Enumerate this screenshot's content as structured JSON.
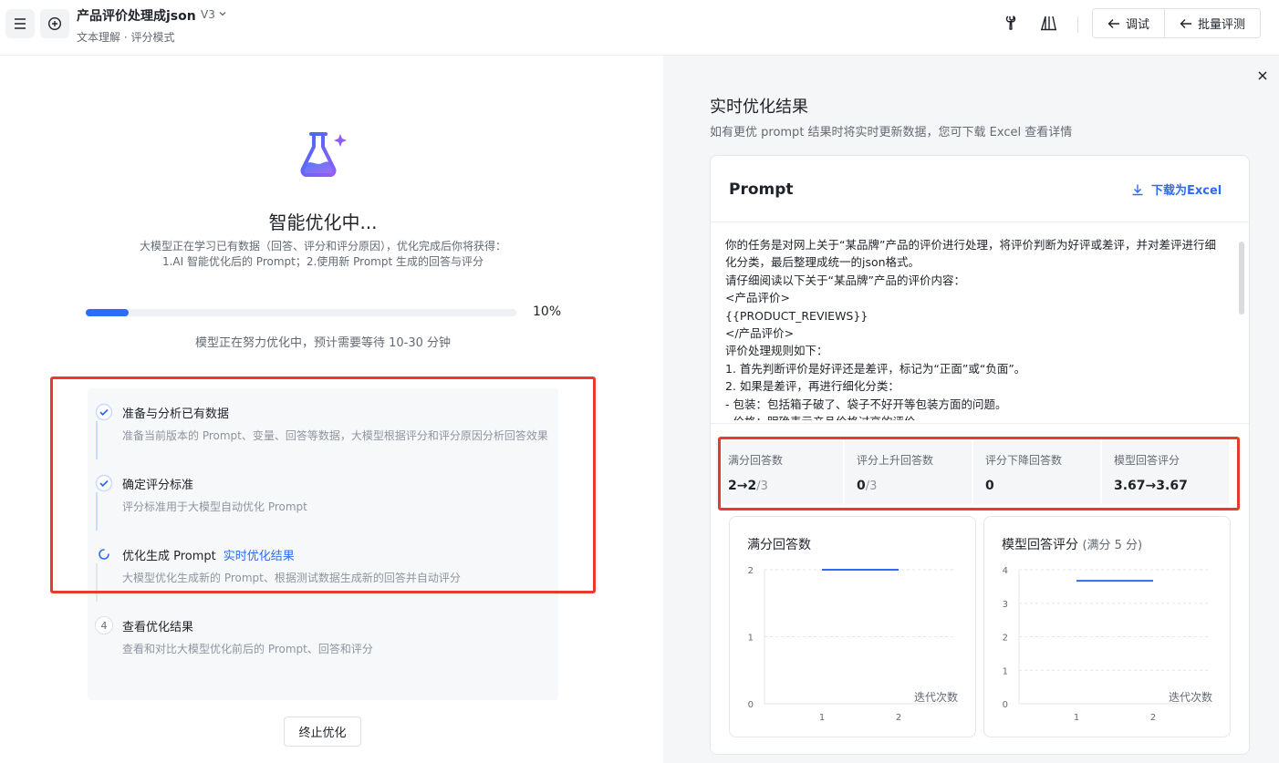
{
  "header": {
    "title": "产品评价处理成json",
    "version": "V3",
    "subtitle": "文本理解 · 评分模式",
    "debug_label": "调试",
    "batch_label": "批量评测"
  },
  "left": {
    "title": "智能优化中...",
    "desc_line1": "大模型正在学习已有数据（回答、评分和评分原因），优化完成后你将获得：",
    "desc_line2": "1.AI 智能优化后的 Prompt；2.使用新 Prompt 生成的回答与评分",
    "progress": 10,
    "progress_label": "10%",
    "progress_note": "模型正在努力优化中，预计需要等待 10-30 分钟",
    "steps": [
      {
        "title": "准备与分析已有数据",
        "desc": "准备当前版本的 Prompt、变量、回答等数据，大模型根据评分和评分原因分析回答效果",
        "status": "done"
      },
      {
        "title": "确定评分标准",
        "desc": "评分标准用于大模型自动优化 Prompt",
        "status": "done"
      },
      {
        "title": "优化生成 Prompt",
        "link": "实时优化结果",
        "desc": "大模型优化生成新的 Prompt、根据测试数据生成新的回答并自动评分",
        "status": "running"
      },
      {
        "title": "查看优化结果",
        "desc": "查看和对比大模型优化前后的 Prompt、回答和评分",
        "status": "pending",
        "number": "4"
      }
    ],
    "stop_label": "终止优化"
  },
  "right": {
    "title": "实时优化结果",
    "desc": "如有更优 prompt 结果时将实时更新数据，您可下载 Excel 查看详情",
    "prompt_label": "Prompt",
    "download_label": "下载为Excel",
    "prompt_lines": [
      "你的任务是对网上关于“某品牌”产品的评价进行处理，将评价判断为好评或差评，并对差评进行细化分类，最后整理成统一的json格式。",
      "请仔细阅读以下关于“某品牌”产品的评价内容：",
      "<产品评价>",
      "{{PRODUCT_REVIEWS}}",
      "</产品评价>",
      "评价处理规则如下：",
      "1. 首先判断评价是好评还是差评，标记为“正面”或“负面”。",
      "2. 如果是差评，再进行细化分类：",
      "- 包装：包括箱子破了、袋子不好开等包装方面的问题。",
      "- 价格：明确表示产品价格过高的评价。"
    ],
    "stats": [
      {
        "label": "满分回答数",
        "value": "2→2",
        "den": "/3"
      },
      {
        "label": "评分上升回答数",
        "value": "0",
        "den": "/3"
      },
      {
        "label": "评分下降回答数",
        "value": "0",
        "den": ""
      },
      {
        "label": "模型回答评分",
        "value": "3.67→3.67",
        "den": ""
      }
    ],
    "charts": [
      {
        "title": "满分回答数",
        "subtitle": ""
      },
      {
        "title": "模型回答评分",
        "subtitle": "(满分 5 分)"
      }
    ]
  },
  "chart_data": [
    {
      "type": "line",
      "title": "满分回答数",
      "x": [
        1,
        2
      ],
      "values": [
        2,
        2
      ],
      "xlabel": "迭代次数",
      "ylim": [
        0,
        2
      ],
      "yticks": [
        "0",
        "1",
        "2"
      ],
      "xticks": [
        "1",
        "2"
      ],
      "grid": true,
      "color": "#2d6cf6"
    },
    {
      "type": "line",
      "title": "模型回答评分",
      "subtitle": "(满分 5 分)",
      "x": [
        1,
        2
      ],
      "values": [
        3.67,
        3.67
      ],
      "xlabel": "迭代次数",
      "ylim": [
        0,
        4
      ],
      "yticks": [
        "0",
        "1",
        "2",
        "3",
        "4"
      ],
      "xticks": [
        "1",
        "2"
      ],
      "grid": true,
      "color": "#2d6cf6"
    }
  ],
  "colors": {
    "accent": "#2d6cf6",
    "highlight_border": "#e93a2f"
  }
}
